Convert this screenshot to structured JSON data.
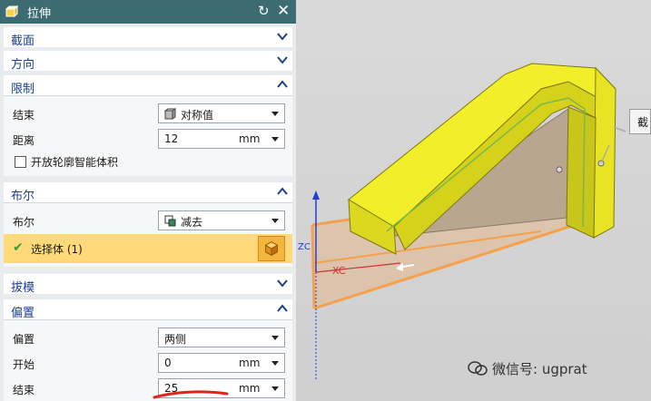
{
  "dialog": {
    "title": "拉伸",
    "sections": {
      "section": {
        "label": "截面"
      },
      "direction": {
        "label": "方向"
      },
      "limits": {
        "label": "限制",
        "end_label": "结束",
        "end_value": "对称值",
        "distance_label": "距离",
        "distance_value": "12",
        "distance_unit": "mm",
        "open_profile_label": "开放轮廓智能体积"
      },
      "boolean": {
        "label": "布尔",
        "bool_label": "布尔",
        "bool_value": "减去",
        "select_body": "选择体 (1)"
      },
      "draft": {
        "label": "拔模"
      },
      "offset": {
        "label": "偏置",
        "offset_label": "偏置",
        "offset_value": "两侧",
        "start_label": "开始",
        "start_value": "0",
        "start_unit": "mm",
        "end_label": "结束",
        "end_value": "25",
        "end_unit": "mm"
      }
    }
  },
  "viewport": {
    "axis_label": "XC",
    "axis_label_z": "ZC",
    "side_label": "截",
    "watermark": "微信号: ugprat"
  },
  "colors": {
    "title_bar": "#3d6b72",
    "section_label": "#1c3f8c",
    "selection_highlight": "#ffd97a",
    "model_yellow": "#f2ee2a",
    "offset_orange": "#f5a04a"
  }
}
